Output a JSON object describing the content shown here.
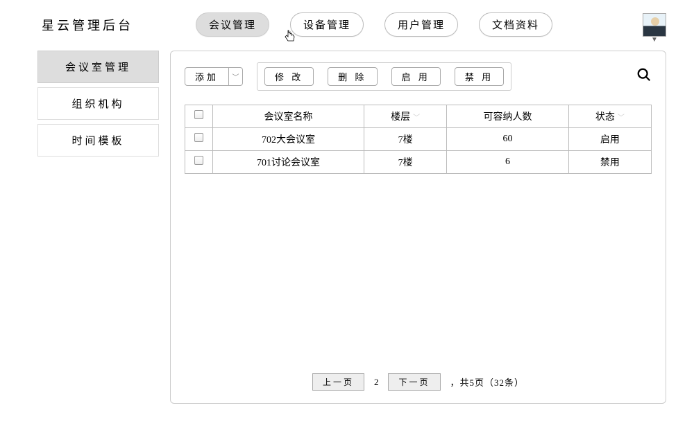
{
  "header": {
    "logo": "星云管理后台",
    "nav": [
      {
        "label": "会议管理",
        "active": true
      },
      {
        "label": "设备管理",
        "active": false
      },
      {
        "label": "用户管理",
        "active": false
      },
      {
        "label": "文档资料",
        "active": false
      }
    ]
  },
  "sidebar": {
    "items": [
      {
        "label": "会议室管理",
        "active": true
      },
      {
        "label": "组织机构",
        "active": false
      },
      {
        "label": "时间模板",
        "active": false
      }
    ]
  },
  "toolbar": {
    "add": "添加",
    "edit": "修 改",
    "delete": "删 除",
    "enable": "启 用",
    "disable": "禁 用"
  },
  "table": {
    "headers": {
      "name": "会议室名称",
      "floor": "楼层",
      "capacity": "可容纳人数",
      "status": "状态"
    },
    "rows": [
      {
        "name": "702大会议室",
        "floor": "7楼",
        "capacity": "60",
        "status": "启用"
      },
      {
        "name": "701讨论会议室",
        "floor": "7楼",
        "capacity": "6",
        "status": "禁用"
      }
    ]
  },
  "pager": {
    "prev": "上一页",
    "current": "2",
    "next": "下一页",
    "summary": "，共5页（32条）"
  }
}
